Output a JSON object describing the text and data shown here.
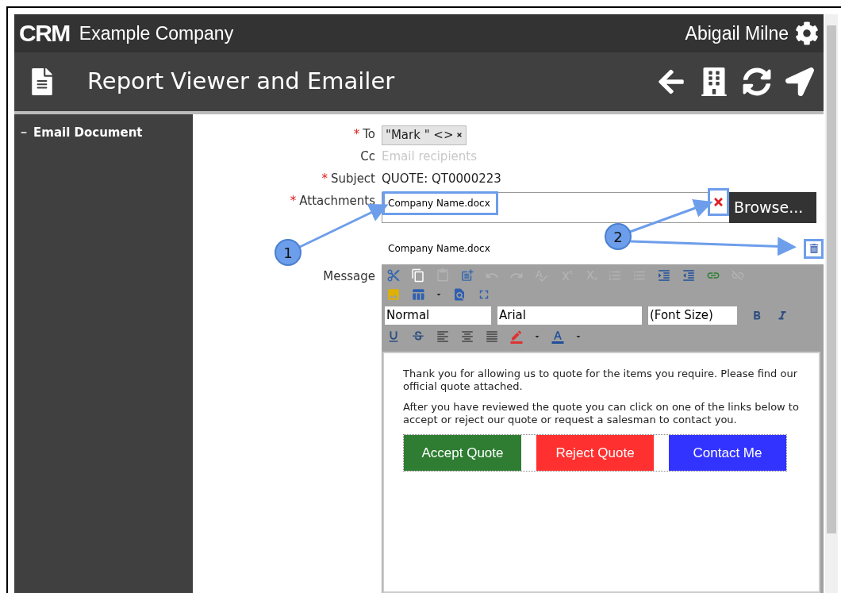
{
  "header": {
    "logo": "CRM",
    "company": "Example Company",
    "user": "Abigail Milne"
  },
  "title_bar": {
    "title": "Report Viewer and Emailer",
    "actions": [
      {
        "kind": "back"
      },
      {
        "kind": "building"
      },
      {
        "kind": "refresh"
      },
      {
        "kind": "navigate"
      }
    ]
  },
  "sidebar": {
    "items": [
      {
        "label": "Email Document",
        "expanded": true
      }
    ]
  },
  "form": {
    "required_mark": "*",
    "fields": [
      {
        "label": "To",
        "required": true,
        "kind": "chips",
        "chips": [
          {
            "label": "\"Mark \" <>"
          }
        ]
      },
      {
        "label": "Cc",
        "required": false,
        "kind": "input",
        "placeholder": "Email recipients"
      },
      {
        "label": "Subject",
        "required": true,
        "kind": "text",
        "value": "QUOTE: QT0000223"
      },
      {
        "label": "Attachments",
        "required": true,
        "kind": "file",
        "value": "Company Name.docx",
        "highlighted": true,
        "clear_highlighted": true,
        "button": "Browse..."
      }
    ],
    "attachments": [
      {
        "name": "Company Name.docx",
        "delete_highlighted": true
      }
    ],
    "message_label": "Message"
  },
  "editor": {
    "toolbar_rows": [
      [
        {
          "kind": "cut",
          "disabled": false
        },
        {
          "kind": "copy",
          "disabled": false
        },
        {
          "kind": "paste",
          "disabled": true
        },
        {
          "kind": "paste-word",
          "disabled": false
        },
        {
          "kind": "undo",
          "disabled": true
        },
        {
          "kind": "redo",
          "disabled": true
        },
        {
          "kind": "spellcheck",
          "disabled": true
        },
        {
          "kind": "superscript",
          "disabled": true
        },
        {
          "kind": "subscript",
          "disabled": true
        },
        {
          "kind": "ordered-list",
          "disabled": true
        },
        {
          "kind": "bulleted-list",
          "disabled": true
        },
        {
          "kind": "indent",
          "disabled": false
        },
        {
          "kind": "outdent",
          "disabled": false
        },
        {
          "kind": "link",
          "disabled": false
        },
        {
          "kind": "unlink",
          "disabled": true
        }
      ],
      [
        {
          "kind": "image",
          "disabled": false
        },
        {
          "kind": "table",
          "disabled": false
        },
        {
          "kind": "caret",
          "disabled": false
        },
        {
          "kind": "find",
          "disabled": false
        },
        {
          "kind": "fullscreen",
          "disabled": false
        }
      ]
    ],
    "selects": [
      {
        "value": "Normal"
      },
      {
        "value": "Arial"
      },
      {
        "value": "(Font Size)"
      }
    ],
    "format_buttons": [
      {
        "kind": "bold",
        "disabled": false
      },
      {
        "kind": "italic",
        "disabled": false
      }
    ],
    "toolbar_row_4": [
      {
        "kind": "underline",
        "disabled": false
      },
      {
        "kind": "strike",
        "disabled": false
      },
      {
        "kind": "align-left",
        "disabled": false
      },
      {
        "kind": "align-center",
        "disabled": false
      },
      {
        "kind": "justify",
        "disabled": false
      },
      {
        "kind": "highlight",
        "disabled": false
      },
      {
        "kind": "caret",
        "disabled": false
      },
      {
        "kind": "font-color",
        "disabled": false
      },
      {
        "kind": "caret",
        "disabled": false
      }
    ],
    "paragraphs": [
      "Thank you for allowing us to quote for the items you require. Please find our official quote attached.",
      "After you have reviewed the quote you can click on one of the links below to accept or reject our quote or request a salesman to contact you."
    ],
    "buttons": [
      {
        "label": "Accept Quote",
        "color": "#2e7d32"
      },
      {
        "label": "Reject Quote",
        "color": "#ff3030"
      },
      {
        "label": "Contact Me",
        "color": "#3333ff"
      }
    ]
  },
  "callouts": [
    {
      "label": "1"
    },
    {
      "label": "2"
    }
  ]
}
